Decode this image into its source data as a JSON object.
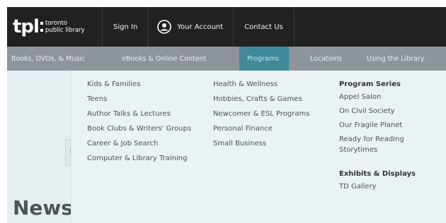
{
  "logo": {
    "mark": "tpl",
    "line1": "toronto",
    "line2": "public library"
  },
  "topnav": {
    "sign_in": "Sign In",
    "your_account": "Your Account",
    "contact_us": "Contact Us"
  },
  "mainnav": {
    "items": [
      {
        "label": "Books, DVDs, & Music"
      },
      {
        "label": "eBooks & Online Content"
      },
      {
        "label": "Programs"
      },
      {
        "label": "Locations"
      },
      {
        "label": "Using the Library"
      }
    ],
    "active_color": "#3f8a9a"
  },
  "programs_menu": {
    "col1": [
      "Kids & Families",
      "Teens",
      "Author Talks & Lectures",
      "Book Clubs & Writers' Groups",
      "Career & Job Search",
      "Computer & Library Training"
    ],
    "col2": [
      "Health & Wellness",
      "Hobbies, Crafts & Games",
      "Newcomer & ESL Programs",
      "Personal Finance",
      "Small Business"
    ],
    "series_heading": "Program Series",
    "series": [
      "Appel Salon",
      "On Civil Society",
      "Our Fragile Planet",
      "Ready for Reading Storytimes"
    ],
    "exhibits_heading": "Exhibits & Displays",
    "exhibits": [
      "TD Gallery"
    ]
  },
  "page": {
    "box_letter": "S",
    "news_heading": "News"
  },
  "colors": {
    "topbar": "#212121",
    "mainnav": "#8d959a",
    "dropdown_bg": "#eaf2f4"
  },
  "icons": {
    "account": "user-circle-icon"
  }
}
